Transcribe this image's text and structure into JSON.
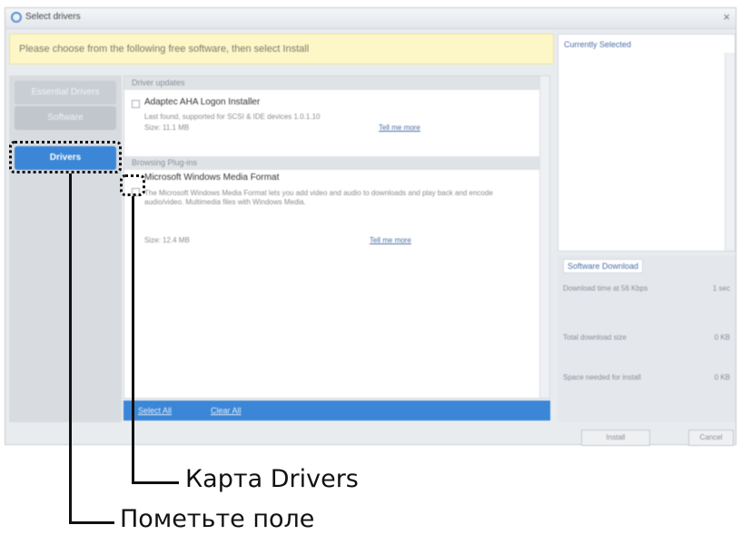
{
  "window": {
    "title": "Select drivers",
    "close_glyph": "×"
  },
  "banner": {
    "text": "Please choose from the following free software, then select Install"
  },
  "nav": {
    "items": [
      {
        "label": "Essential Drivers"
      },
      {
        "label": "Software"
      },
      {
        "label": "Drivers"
      }
    ]
  },
  "list": {
    "groups": [
      {
        "header": "Driver updates",
        "item_title": "Adaptec AHA Logon Installer",
        "item_desc": "Last found, supported for SCSI & IDE devices 1.0.1.10",
        "item_size": "Size: 11.1 MB",
        "item_link": "Tell me more"
      },
      {
        "header": "Browsing Plug-ins",
        "item_title": "Microsoft Windows Media Format",
        "item_desc": "The Microsoft Windows Media Format lets you add video and audio to downloads and play back and encode audio/video. Multimedia files with Windows Media.",
        "item_size": "Size: 12.4 MB",
        "item_link": "Tell me more"
      }
    ]
  },
  "bottom_bar": {
    "select_all": "Select All",
    "clear_all": "Clear All"
  },
  "right_panel": {
    "title": "Currently Selected"
  },
  "download_panel": {
    "title": "Software Download",
    "rows": [
      {
        "label": "Download time at 56 Kbps",
        "value": "1 sec"
      },
      {
        "label": "Total download size",
        "value": "0 KB"
      },
      {
        "label": "Space needed for install",
        "value": "0 KB"
      }
    ]
  },
  "footer": {
    "install": "Install",
    "cancel": "Cancel"
  },
  "annotations": {
    "drivers_tab_label": "Карта Drivers",
    "checkbox_label": "Пометьте поле"
  },
  "colors": {
    "accent": "#3b86d6",
    "banner_bg": "#fdf6c7"
  }
}
